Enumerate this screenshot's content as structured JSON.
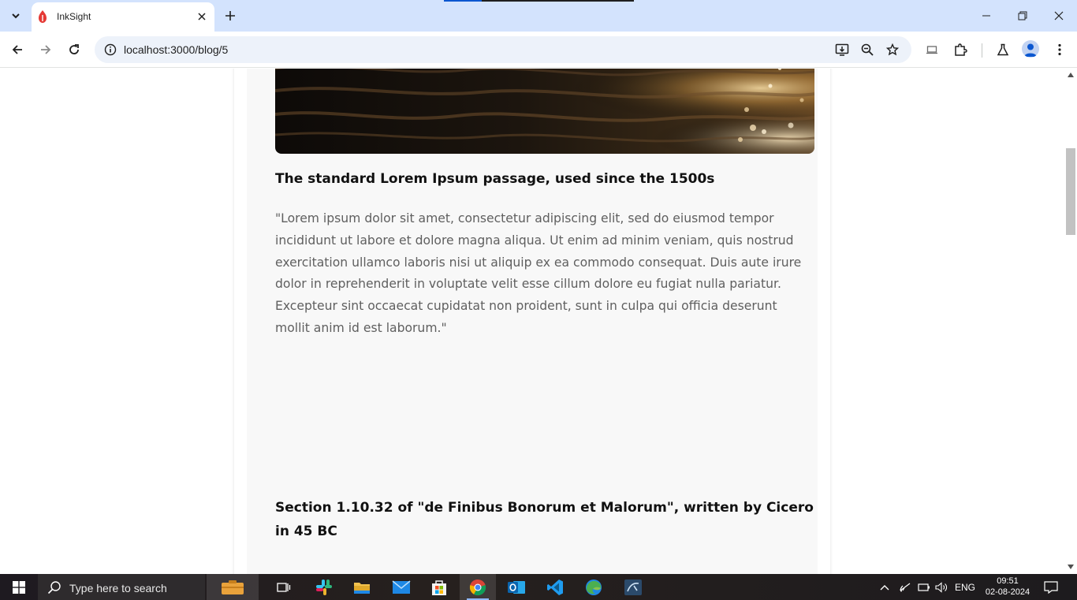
{
  "browser": {
    "tab": {
      "title": "InkSight"
    },
    "address": {
      "url": "localhost:3000/blog/5"
    }
  },
  "article": {
    "heading_1": "The standard Lorem Ipsum passage, used since the 1500s",
    "paragraph_1": "\"Lorem ipsum dolor sit amet, consectetur adipiscing elit, sed do eiusmod tempor incididunt ut labore et dolore magna aliqua. Ut enim ad minim veniam, quis nostrud exercitation ullamco laboris nisi ut aliquip ex ea commodo consequat. Duis aute irure dolor in reprehenderit in voluptate velit esse cillum dolore eu fugiat nulla pariatur. Excepteur sint occaecat cupidatat non proident, sunt in culpa qui officia deserunt mollit anim id est laborum.\"",
    "heading_2": "Section 1.10.32 of \"de Finibus Bonorum et Malorum\", written by Cicero in 45 BC"
  },
  "taskbar": {
    "search_placeholder": "Type here to search",
    "language": "ENG",
    "time": "09:51",
    "date": "02-08-2024",
    "apps": [
      "file-explorer-folder",
      "task-view",
      "slack",
      "file-explorer",
      "mail",
      "microsoft-store",
      "chrome",
      "outlook",
      "vscode",
      "edge",
      "mysql-workbench"
    ]
  },
  "colors": {
    "tabstrip": "#d3e3fd",
    "omnibox": "#edf2fa",
    "card_bg": "#f8f8f8",
    "heading": "#111111",
    "paragraph": "#5f5f5f"
  }
}
